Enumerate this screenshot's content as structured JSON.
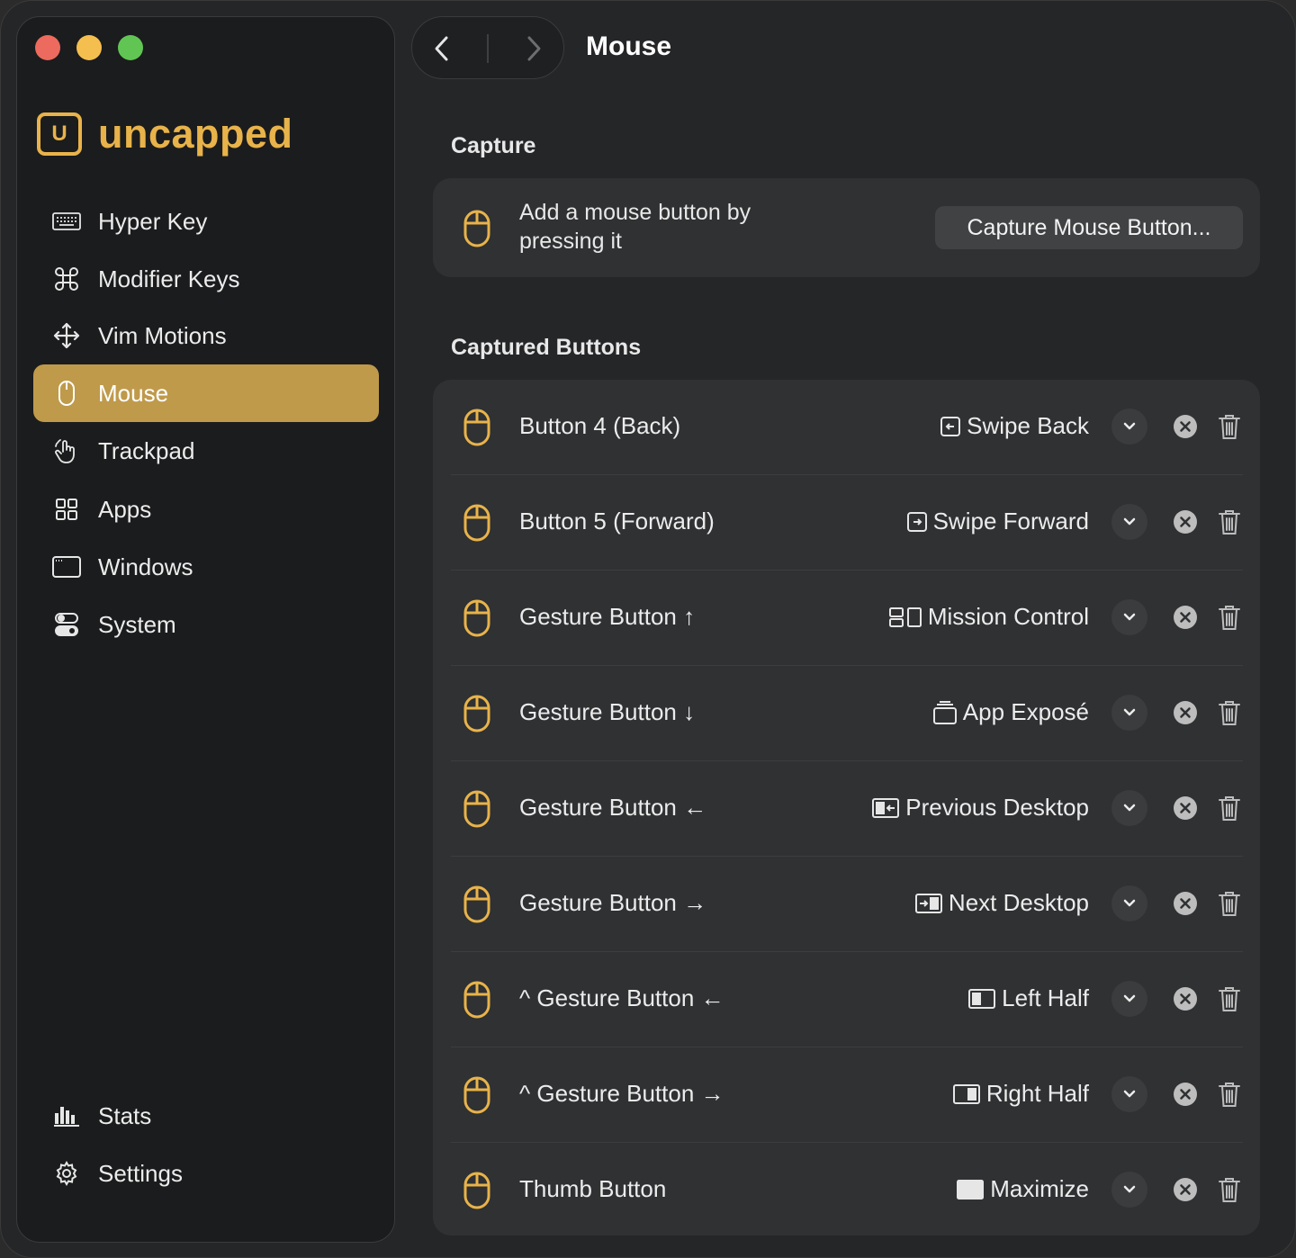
{
  "app": {
    "name": "uncapped",
    "logo_letter": "U"
  },
  "header": {
    "title": "Mouse"
  },
  "sidebar": {
    "items": [
      {
        "label": "Hyper Key",
        "icon": "keyboard-icon"
      },
      {
        "label": "Modifier Keys",
        "icon": "command-icon"
      },
      {
        "label": "Vim Motions",
        "icon": "move-arrows-icon"
      },
      {
        "label": "Mouse",
        "icon": "mouse-icon",
        "active": true
      },
      {
        "label": "Trackpad",
        "icon": "hand-pointer-icon"
      },
      {
        "label": "Apps",
        "icon": "apps-grid-icon"
      },
      {
        "label": "Windows",
        "icon": "window-icon"
      },
      {
        "label": "System",
        "icon": "toggles-icon"
      }
    ],
    "bottom_items": [
      {
        "label": "Stats",
        "icon": "bar-chart-icon"
      },
      {
        "label": "Settings",
        "icon": "gear-icon"
      }
    ]
  },
  "capture": {
    "section_title": "Capture",
    "description": "Add a mouse button by pressing it",
    "button_label": "Capture Mouse Button..."
  },
  "captured": {
    "section_title": "Captured Buttons",
    "rows": [
      {
        "label": "Button 4 (Back)",
        "action": "Swipe Back",
        "action_icon": "swipe-back-icon"
      },
      {
        "label": "Button 5 (Forward)",
        "action": "Swipe Forward",
        "action_icon": "swipe-forward-icon"
      },
      {
        "label": "Gesture Button ↑",
        "action": "Mission Control",
        "action_icon": "mission-control-icon"
      },
      {
        "label": "Gesture Button ↓",
        "action": "App Exposé",
        "action_icon": "app-expose-icon"
      },
      {
        "label": "Gesture Button ←",
        "action": "Previous Desktop",
        "action_icon": "previous-desktop-icon"
      },
      {
        "label": "Gesture Button →",
        "action": "Next Desktop",
        "action_icon": "next-desktop-icon"
      },
      {
        "label": "^ Gesture Button ←",
        "action": "Left Half",
        "action_icon": "left-half-icon"
      },
      {
        "label": "^ Gesture Button →",
        "action": "Right Half",
        "action_icon": "right-half-icon"
      },
      {
        "label": "Thumb Button",
        "action": "Maximize",
        "action_icon": "maximize-icon"
      }
    ]
  },
  "colors": {
    "accent": "#e8b34a",
    "active_nav": "#bf9a4b",
    "card_bg": "#2f3133",
    "window_bg": "#242628",
    "sidebar_bg": "#1b1c1d"
  }
}
